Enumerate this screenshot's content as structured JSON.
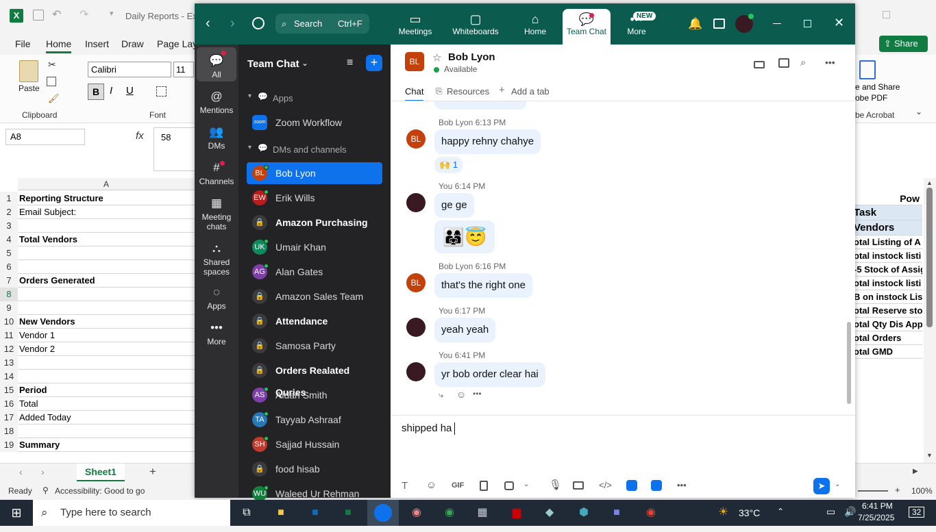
{
  "excel": {
    "title": "Daily Reports - Ex",
    "tabs": [
      "File",
      "Home",
      "Insert",
      "Draw",
      "Page Layo"
    ],
    "active_tab": "Home",
    "ribbon": {
      "paste": "Paste",
      "clipboard": "Clipboard",
      "font_name": "Calibri",
      "font_size": "11",
      "font_group": "Font",
      "adobe1": "e and Share",
      "adobe2": "obe PDF",
      "adobe3": "be Acrobat",
      "share": "Share"
    },
    "name_box": "A8",
    "formula_value": "58",
    "col_header": "A",
    "rows": [
      {
        "n": "1",
        "text": "Reporting Structure",
        "bold": true
      },
      {
        "n": "2",
        "text": "Email Subject:",
        "bold": false
      },
      {
        "n": "3",
        "text": "",
        "bold": false
      },
      {
        "n": "4",
        "text": "Total Vendors",
        "bold": true
      },
      {
        "n": "5",
        "text": "",
        "bold": false
      },
      {
        "n": "6",
        "text": "",
        "bold": false
      },
      {
        "n": "7",
        "text": "Orders Generated",
        "bold": true
      },
      {
        "n": "8",
        "text": "",
        "bold": false
      },
      {
        "n": "9",
        "text": "",
        "bold": false
      },
      {
        "n": "10",
        "text": "New Vendors",
        "bold": true
      },
      {
        "n": "11",
        "text": "Vendor 1",
        "bold": false
      },
      {
        "n": "12",
        "text": "Vendor 2",
        "bold": false
      },
      {
        "n": "13",
        "text": "",
        "bold": false
      },
      {
        "n": "14",
        "text": "",
        "bold": false
      },
      {
        "n": "15",
        "text": "Period",
        "bold": true
      },
      {
        "n": "16",
        "text": "Total",
        "bold": false
      },
      {
        "n": "17",
        "text": "Added Today",
        "bold": false
      },
      {
        "n": "18",
        "text": "",
        "bold": false
      },
      {
        "n": "19",
        "text": "Summary",
        "bold": true
      }
    ],
    "right_cells": [
      "Pow",
      "Task",
      "Vendors",
      "otal Listing of A",
      "otal instock listi",
      "-5 Stock of Assig",
      "otal instock listi",
      "B on instock Lis",
      "otal Reserve sto",
      "otal Qty Dis App",
      "otal Orders",
      "otal GMD"
    ],
    "sheet_tab": "Sheet1",
    "status_ready": "Ready",
    "status_access": "Accessibility: Good to go",
    "zoom": "100%"
  },
  "zoom": {
    "search_label": "Search",
    "search_shortcut": "Ctrl+F",
    "top_nav": [
      "Meetings",
      "Whiteboards",
      "Home",
      "Team Chat",
      "More"
    ],
    "new_badge": "NEW",
    "rail": [
      "All",
      "Mentions",
      "DMs",
      "Channels",
      "Meeting chats",
      "Shared spaces",
      "Apps",
      "More"
    ],
    "list_title": "Team Chat",
    "section_apps": "Apps",
    "app_zoom": "Zoom Workflow",
    "zoom_logo": "zoom",
    "section_dms": "DMs and channels",
    "items": [
      {
        "name": "Bob Lyon",
        "initials": "BL",
        "color": "#c2410c",
        "lock": false,
        "bold": false,
        "active": true,
        "dot": true
      },
      {
        "name": "Erik Wills",
        "initials": "EW",
        "color": "#b91c1c",
        "lock": false,
        "bold": false,
        "active": false,
        "dot": true
      },
      {
        "name": "Amazon Purchasing",
        "initials": "",
        "color": "",
        "lock": true,
        "bold": true,
        "active": false,
        "dot": false
      },
      {
        "name": "Umair Khan",
        "initials": "UK",
        "color": "#0f8a5f",
        "lock": false,
        "bold": false,
        "active": false,
        "dot": true
      },
      {
        "name": "Alan Gates",
        "initials": "AG",
        "color": "#7e3fa8",
        "lock": false,
        "bold": false,
        "active": false,
        "dot": true
      },
      {
        "name": "Amazon Sales Team",
        "initials": "",
        "color": "",
        "lock": true,
        "bold": false,
        "active": false,
        "dot": false
      },
      {
        "name": "Attendance",
        "initials": "",
        "color": "",
        "lock": true,
        "bold": true,
        "active": false,
        "dot": false
      },
      {
        "name": "Samosa Party",
        "initials": "",
        "color": "",
        "lock": true,
        "bold": false,
        "active": false,
        "dot": false
      },
      {
        "name": "Orders Realated Quries",
        "initials": "",
        "color": "",
        "lock": true,
        "bold": true,
        "active": false,
        "dot": false
      },
      {
        "name": "Aidan Smith",
        "initials": "AS",
        "color": "#7e3fa8",
        "lock": false,
        "bold": false,
        "active": false,
        "dot": true
      },
      {
        "name": "Tayyab Ashraaf",
        "initials": "TA",
        "color": "#2776b8",
        "lock": false,
        "bold": false,
        "active": false,
        "dot": true
      },
      {
        "name": "Sajjad Hussain",
        "initials": "SH",
        "color": "#c0392b",
        "lock": false,
        "bold": false,
        "active": false,
        "dot": true
      },
      {
        "name": "food hisab",
        "initials": "",
        "color": "",
        "lock": true,
        "bold": false,
        "active": false,
        "dot": false
      },
      {
        "name": "Waleed Ur Rehman",
        "initials": "WU",
        "color": "#15803d",
        "lock": false,
        "bold": false,
        "active": false,
        "dot": true
      }
    ],
    "chat": {
      "contact_name": "Bob Lyon",
      "contact_initials": "BL",
      "status": "Available",
      "tabs": [
        "Chat",
        "Resources",
        "Add a tab"
      ],
      "messages": [
        {
          "sender": "Bob Lyon",
          "time": "6:13 PM",
          "text": "happy rehny chahye",
          "me": false
        },
        {
          "sender": "You",
          "time": "6:14 PM",
          "text": "ge ge",
          "me": true
        },
        {
          "sender": "Bob Lyon",
          "time": "6:16 PM",
          "text": "that's the right one",
          "me": false
        },
        {
          "sender": "You",
          "time": "6:17 PM",
          "text": "yeah yeah",
          "me": true
        },
        {
          "sender": "You",
          "time": "6:41 PM",
          "text": "yr bob order clear hai",
          "me": true
        }
      ],
      "reaction_count": "1",
      "compose_text": "shipped ha",
      "gif": "GIF"
    }
  },
  "taskbar": {
    "search_placeholder": "Type here to search",
    "weather": "33°C",
    "time": "6:41 PM",
    "date": "7/25/2025",
    "notif": "32"
  }
}
